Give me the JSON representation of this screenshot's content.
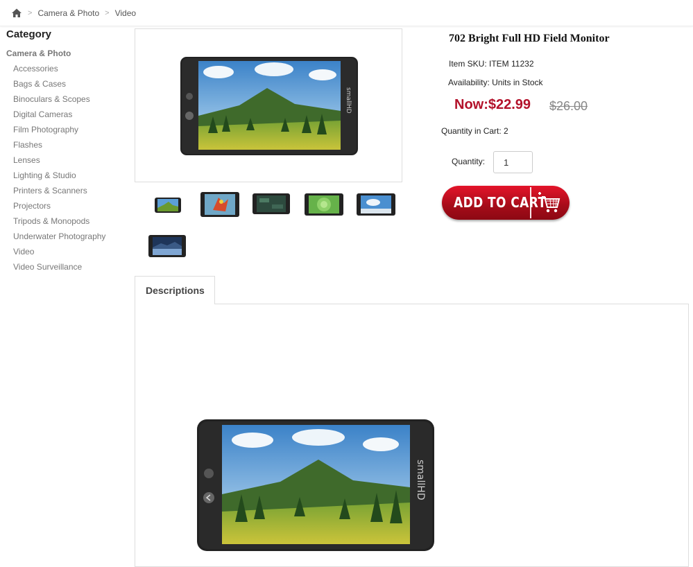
{
  "breadcrumb": {
    "items": [
      "Camera & Photo",
      "Video"
    ],
    "separator": ">"
  },
  "sidebar": {
    "heading": "Category",
    "parent": "Camera & Photo",
    "items": [
      "Accessories",
      "Bags & Cases",
      "Binoculars & Scopes",
      "Digital Cameras",
      "Film Photography",
      "Flashes",
      "Lenses",
      "Lighting & Studio",
      "Printers & Scanners",
      "Projectors",
      "Tripods & Monopods",
      "Underwater Photography",
      "Video",
      "Video Surveillance"
    ]
  },
  "product": {
    "title": "702 Bright Full HD Field Monitor",
    "sku": "Item SKU: ITEM 11232",
    "availability": "Availability: Units in Stock",
    "price_now": "Now:$22.99",
    "price_old": "$26.00",
    "cart_qty": "Quantity in Cart: 2",
    "quantity_label": "Quantity:",
    "quantity_value": "1",
    "add_to_cart": "ADD TO CART",
    "monitor_brand": "smallHD"
  },
  "thumbnails": [
    "landscape",
    "parrot",
    "dark-ui",
    "succulent",
    "sky",
    "night-lake"
  ],
  "tabs": {
    "descriptions": "Descriptions"
  },
  "colors": {
    "price": "#b3122b",
    "button": "#c20f22"
  }
}
